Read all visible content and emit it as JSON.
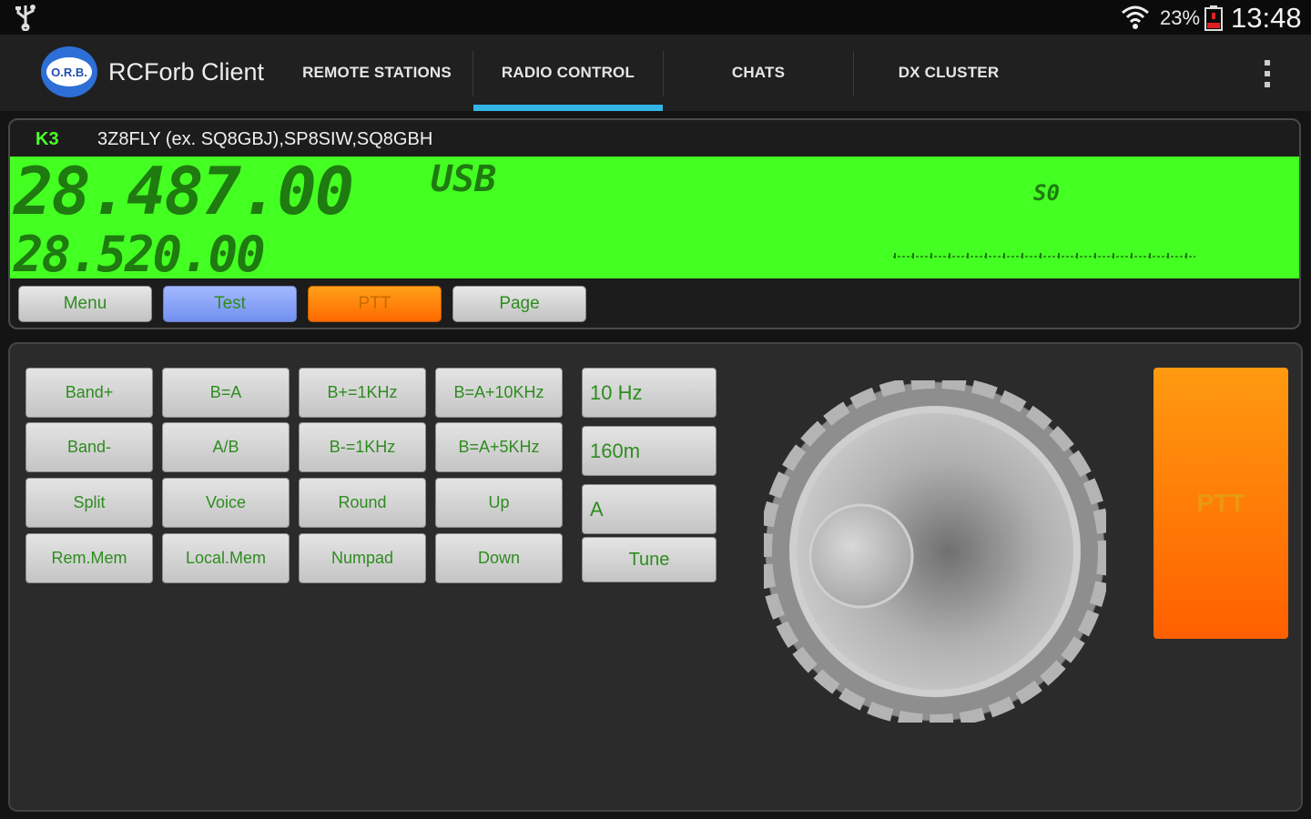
{
  "status_bar": {
    "battery_percent": "23%",
    "time": "13:48",
    "icons": [
      "usb-icon",
      "wifi-icon",
      "battery-icon"
    ]
  },
  "action_bar": {
    "logo_text": "O.R.B.",
    "app_title": "RCForb Client",
    "tabs": [
      {
        "label": "REMOTE STATIONS",
        "selected": false
      },
      {
        "label": "RADIO CONTROL",
        "selected": true
      },
      {
        "label": "CHATS",
        "selected": false
      },
      {
        "label": "DX CLUSTER",
        "selected": false
      }
    ],
    "accent_color": "#33b5e5"
  },
  "radio": {
    "model": "K3",
    "stations": "3Z8FLY (ex. SQ8GBJ),SP8SIW,SQ8GBH",
    "vfo_a": "28.487.00",
    "vfo_b": "28.520.00",
    "mode": "USB",
    "s_meter": "S0",
    "lcd_color": "#44ff22",
    "buttons": [
      "Menu",
      "Test",
      "PTT",
      "Page"
    ]
  },
  "controls": {
    "grid": [
      [
        "Band+",
        "B=A",
        "B+=1KHz",
        "B=A+10KHz"
      ],
      [
        "Band-",
        "A/B",
        "B-=1KHz",
        "B=A+5KHz"
      ],
      [
        "Split",
        "Voice",
        "Round",
        "Up"
      ],
      [
        "Rem.Mem",
        "Local.Mem",
        "Numpad",
        "Down"
      ]
    ],
    "selectors": {
      "step": "10 Hz",
      "band": "160m",
      "vfo": "A",
      "tune": "Tune"
    },
    "ptt": "PTT"
  }
}
